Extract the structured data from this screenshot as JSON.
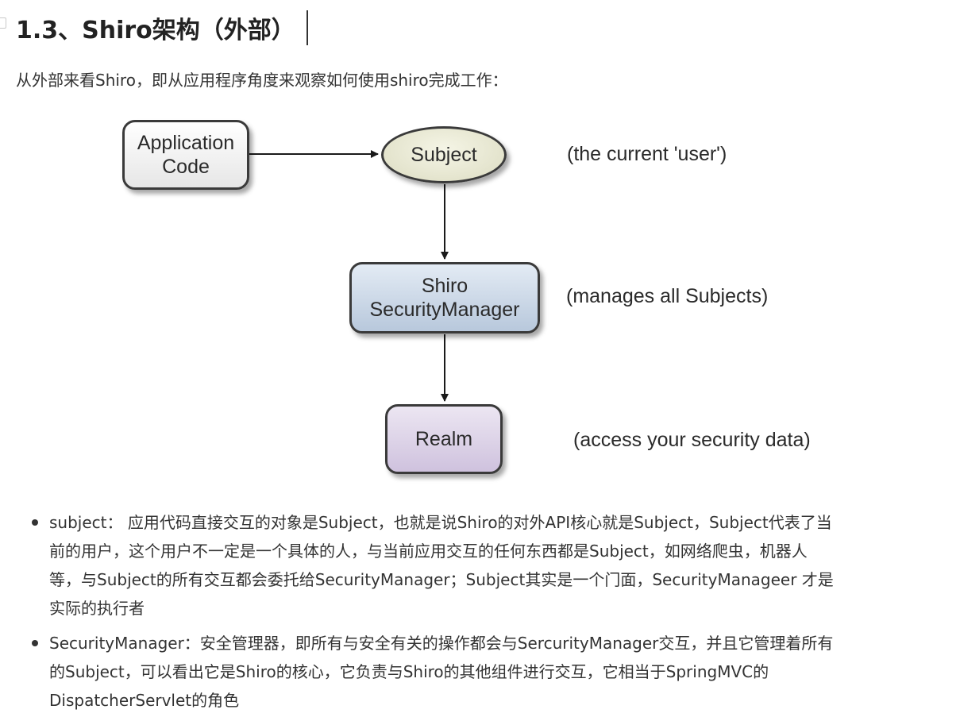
{
  "heading": {
    "title": "1.3、Shiro架构（外部）"
  },
  "intro": "从外部来看Shiro，即从应用程序角度来观察如何使用shiro完成工作：",
  "diagram": {
    "nodes": {
      "application_code": [
        "Application",
        "Code"
      ],
      "subject": "Subject",
      "security_manager": [
        "Shiro",
        "SecurityManager"
      ],
      "realm": "Realm"
    },
    "notes": {
      "subject": "(the current 'user')",
      "security_manager": "(manages all Subjects)",
      "realm": "(access your security data)"
    },
    "colors": {
      "application_code_fill": "#eeeeee",
      "subject_fill": "#e8e8d2",
      "security_manager_fill": "#c8d6e6",
      "realm_fill": "#ddd3e8",
      "border": "#3a3a3a"
    }
  },
  "bullets": [
    {
      "lines": [
        "subject： 应用代码直接交互的对象是Subject，也就是说Shiro的对外API核心就是Subject，Subject代表了当",
        "前的用户，这个用户不一定是一个具体的人，与当前应用交互的任何东西都是Subject，如网络爬虫，机器人",
        "等，与Subject的所有交互都会委托给SecurityManager；Subject其实是一个门面，SecurityManageer 才是",
        "实际的执行者"
      ]
    },
    {
      "lines": [
        "SecurityManager：安全管理器，即所有与安全有关的操作都会与SercurityManager交互，并且它管理着所有",
        "的Subject，可以看出它是Shiro的核心，它负责与Shiro的其他组件进行交互，它相当于SpringMVC的",
        "DispatcherServlet的角色"
      ]
    }
  ]
}
